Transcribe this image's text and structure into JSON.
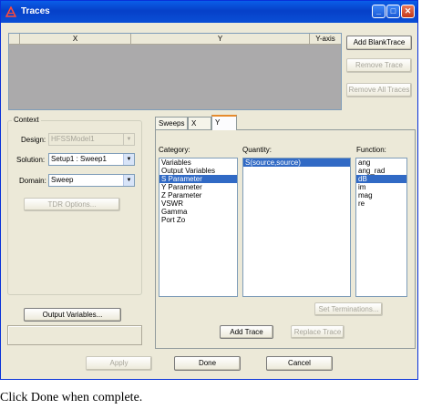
{
  "window": {
    "title": "Traces"
  },
  "traces_table": {
    "columns": [
      "X",
      "Y",
      "Y-axis"
    ]
  },
  "trace_buttons": {
    "add_blank": "Add BlankTrace",
    "remove": "Remove Trace",
    "remove_all": "Remove All Traces"
  },
  "context": {
    "title": "Context",
    "design_label": "Design:",
    "design_value": "HFSSModel1",
    "solution_label": "Solution:",
    "solution_value": "Setup1 : Sweep1",
    "domain_label": "Domain:",
    "domain_value": "Sweep",
    "tdr_options": "TDR Options..."
  },
  "tabs": [
    "Sweeps",
    "X",
    "Y"
  ],
  "category": {
    "label": "Category:",
    "items": [
      "Variables",
      "Output Variables",
      "S Parameter",
      "Y Parameter",
      "Z Parameter",
      "VSWR",
      "Gamma",
      "Port Zo"
    ],
    "selected": "S Parameter"
  },
  "quantity": {
    "label": "Quantity:",
    "items": [
      "S(source,source)"
    ],
    "selected": "S(source,source)"
  },
  "function": {
    "label": "Function:",
    "items": [
      "ang",
      "ang_rad",
      "dB",
      "im",
      "mag",
      "re"
    ],
    "selected": "dB"
  },
  "panel_buttons": {
    "set_terminations": "Set Terminations...",
    "add_trace": "Add Trace",
    "replace_trace": "Replace Trace"
  },
  "output_variables": "Output Variables...",
  "bottom_buttons": {
    "apply": "Apply",
    "done": "Done",
    "cancel": "Cancel"
  },
  "caption": "Click Done when complete."
}
